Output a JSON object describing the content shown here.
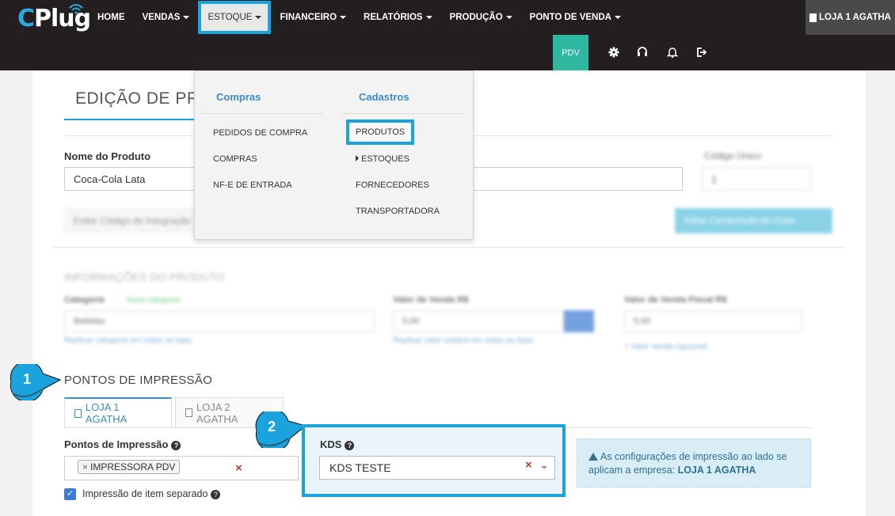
{
  "brand": {
    "logo_text": "Plug",
    "logo_prefix": "C"
  },
  "nav": {
    "items": [
      {
        "label": "HOME",
        "has_caret": false
      },
      {
        "label": "VENDAS",
        "has_caret": true
      },
      {
        "label": "ESTOQUE",
        "has_caret": true,
        "active": true
      },
      {
        "label": "FINANCEIRO",
        "has_caret": true
      },
      {
        "label": "RELATÓRIOS",
        "has_caret": true
      },
      {
        "label": "PRODUÇÃO",
        "has_caret": true
      },
      {
        "label": "PONTO DE VENDA",
        "has_caret": true
      }
    ],
    "store_label": "LOJA 1 AGATHA",
    "pdv_label": "PDV",
    "toolbar_icons": [
      "gear-icon",
      "headset-icon",
      "bell-icon",
      "logout-icon"
    ]
  },
  "page": {
    "title": "EDIÇÃO DE PRO",
    "product_name_label": "Nome do Produto",
    "product_name_value": "Coca-Cola Lata",
    "codigo_label": "Código Único",
    "codigo_value": "1",
    "integration_button": "Exibir Código de Integração",
    "add_button": "Editar Composição do Custo"
  },
  "dropdown": {
    "col1_heading": "Compras",
    "col1_items": [
      "PEDIDOS DE COMPRA",
      "COMPRAS",
      "NF-E DE ENTRADA"
    ],
    "col2_heading": "Cadastros",
    "col2_items": [
      "PRODUTOS",
      "ESTOQUES",
      "FORNECEDORES",
      "TRANSPORTADORA"
    ]
  },
  "info_section": {
    "title": "INFORMAÇÕES DO PRODUTO",
    "categoria_label": "Categoria",
    "nova_categoria": "Nova categoria",
    "categoria_value": "Bebidas",
    "categoria_link": "Replicar categoria em todas as lojas",
    "valor_venda_label": "Valor de Venda R$",
    "valor_venda_value": "5,00",
    "valor_venda_link": "Replicar valor unitário em todas as lojas",
    "valor_venda_fiscal_label": "Valor de Venda Fiscal R$",
    "valor_venda_fiscal_value": "5,00",
    "valor_venda_fiscal_link": "+ Valor Venda Opcional"
  },
  "callouts": {
    "one": "1",
    "two": "2"
  },
  "print_section": {
    "title": "PONTOS DE IMPRESSÃO",
    "tabs": [
      "LOJA 1 AGATHA",
      "LOJA 2 AGATHA"
    ],
    "pontos_label": "Pontos de Impressão",
    "tag_label": "IMPRESSORA PDV",
    "tag_remove": "×",
    "clear": "×",
    "separate_label": "Impressão de item separado",
    "checkbox_mark": "✓",
    "help": "?",
    "kds_label": "KDS",
    "kds_value": "KDS TESTE",
    "info_text": "As configurações de impressão ao lado se aplicam a empresa:",
    "info_company": "LOJA 1 AGATHA"
  },
  "colors": {
    "navbar": "#231f20",
    "accent": "#1aa3dc",
    "pdv": "#2eb8a0",
    "link": "#3a8bc8"
  }
}
